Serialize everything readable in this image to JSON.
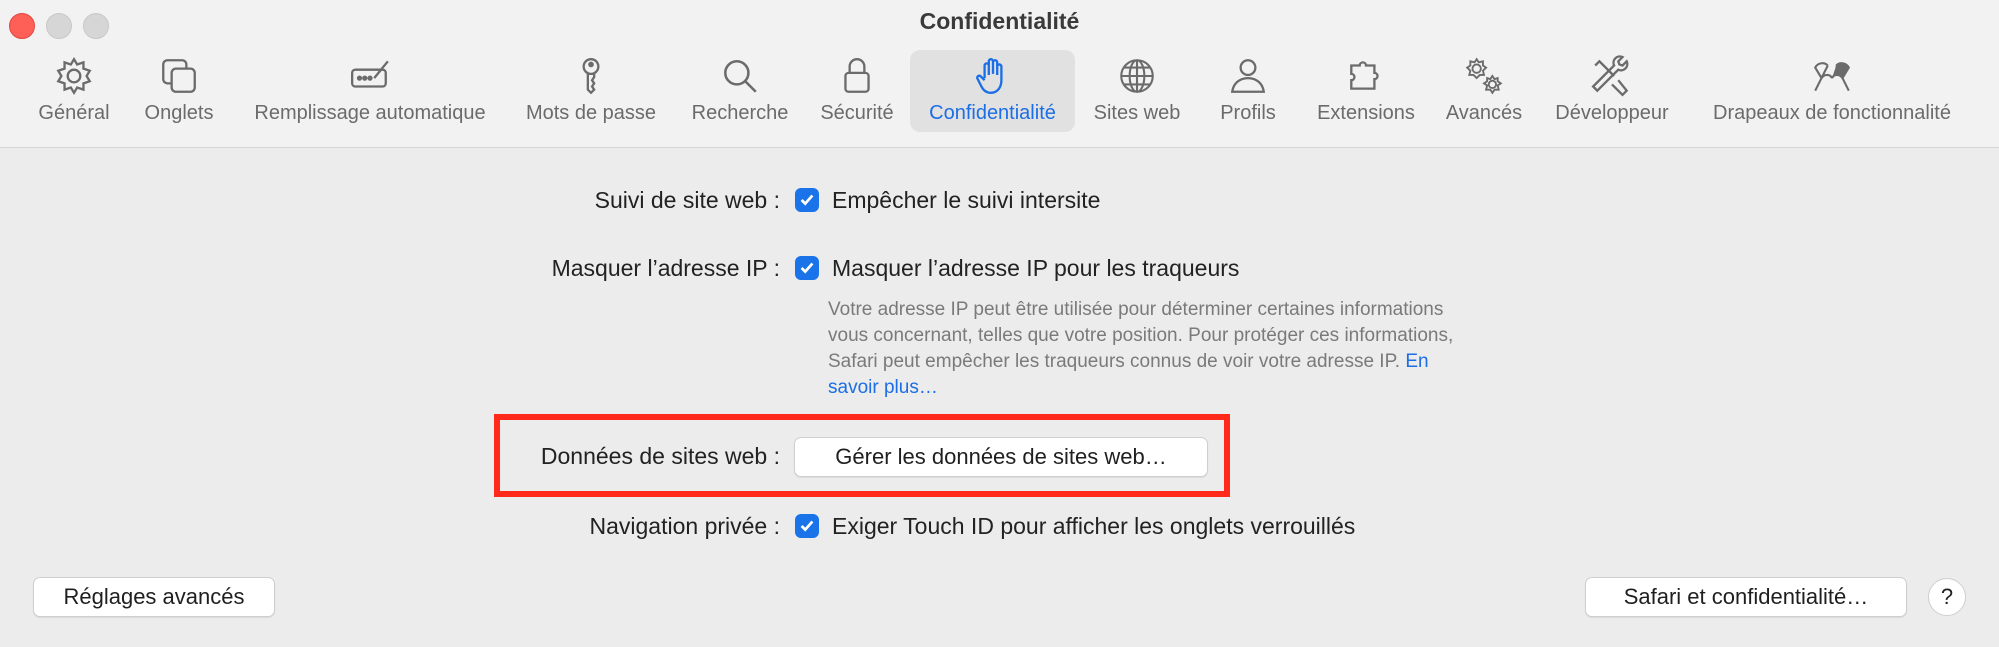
{
  "window": {
    "title": "Confidentialité"
  },
  "toolbar": {
    "tabs": [
      {
        "label": "Général",
        "icon": "gear-icon"
      },
      {
        "label": "Onglets",
        "icon": "tabs-icon"
      },
      {
        "label": "Remplissage automatique",
        "icon": "autofill-icon"
      },
      {
        "label": "Mots de passe",
        "icon": "key-icon"
      },
      {
        "label": "Recherche",
        "icon": "search-icon"
      },
      {
        "label": "Sécurité",
        "icon": "lock-icon"
      },
      {
        "label": "Confidentialité",
        "icon": "hand-icon",
        "active": true
      },
      {
        "label": "Sites web",
        "icon": "globe-icon"
      },
      {
        "label": "Profils",
        "icon": "person-icon"
      },
      {
        "label": "Extensions",
        "icon": "puzzle-icon"
      },
      {
        "label": "Avancés",
        "icon": "gears-icon"
      },
      {
        "label": "Développeur",
        "icon": "tools-icon"
      },
      {
        "label": "Drapeaux de fonctionnalité",
        "icon": "flags-icon"
      }
    ]
  },
  "settings": {
    "tracking": {
      "label": "Suivi de site web :",
      "option": "Empêcher le suivi intersite",
      "checked": true
    },
    "hide_ip": {
      "label": "Masquer l’adresse IP :",
      "option": "Masquer l’adresse IP pour les traqueurs",
      "checked": true,
      "description": "Votre adresse IP peut être utilisée pour déterminer certaines informations vous concernant, telles que votre position. Pour protéger ces informations, Safari peut empêcher les traqueurs connus de voir votre adresse IP.",
      "link": "En savoir plus…"
    },
    "website_data": {
      "label": "Données de sites web :",
      "button": "Gérer les données de sites web…"
    },
    "private_browsing": {
      "label": "Navigation privée :",
      "option": "Exiger Touch ID pour afficher les onglets verrouillés",
      "checked": true
    }
  },
  "footer": {
    "advanced_button": "Réglages avancés",
    "privacy_button": "Safari et confidentialité…",
    "help": "?"
  },
  "colors": {
    "accent": "#1b6ee6",
    "highlight": "#ff2a1a",
    "close": "#fe5f57"
  }
}
